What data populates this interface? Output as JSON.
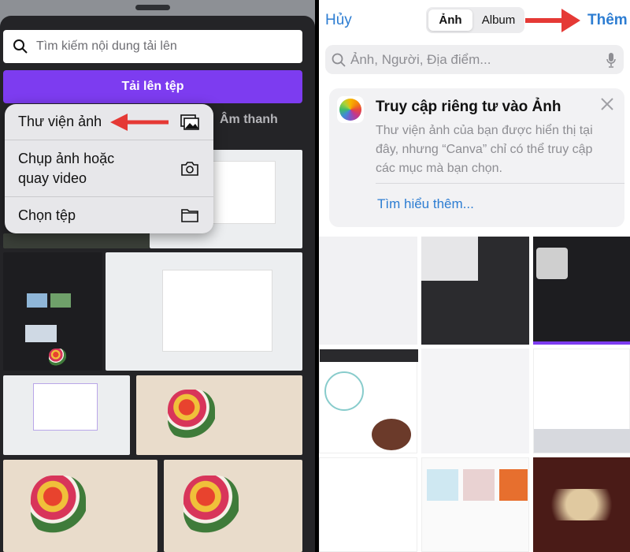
{
  "left_screen": {
    "search_placeholder": "Tìm kiếm nội dung tải lên",
    "upload_button": "Tải lên tệp",
    "tab_audio": "Âm thanh",
    "menu": [
      {
        "label": "Thư viện ảnh",
        "icon": "photo-library-icon"
      },
      {
        "label": "Chụp ảnh hoặc quay video",
        "icon": "camera-icon"
      },
      {
        "label": "Chọn tệp",
        "icon": "folder-icon"
      }
    ],
    "annotation_arrow_color": "#e53935"
  },
  "right_screen": {
    "cancel": "Hủy",
    "segments": [
      "Ảnh",
      "Album"
    ],
    "add": "Thêm",
    "search_placeholder": "Ảnh, Người, Địa điểm...",
    "card": {
      "title": "Truy cập riêng tư vào Ảnh",
      "body": "Thư viện ảnh của bạn được hiển thị tại đây, nhưng “Canva” chỉ có thể truy cập các mục mà bạn chọn.",
      "link": "Tìm hiểu thêm..."
    },
    "accent_color": "#2d7dd2"
  }
}
